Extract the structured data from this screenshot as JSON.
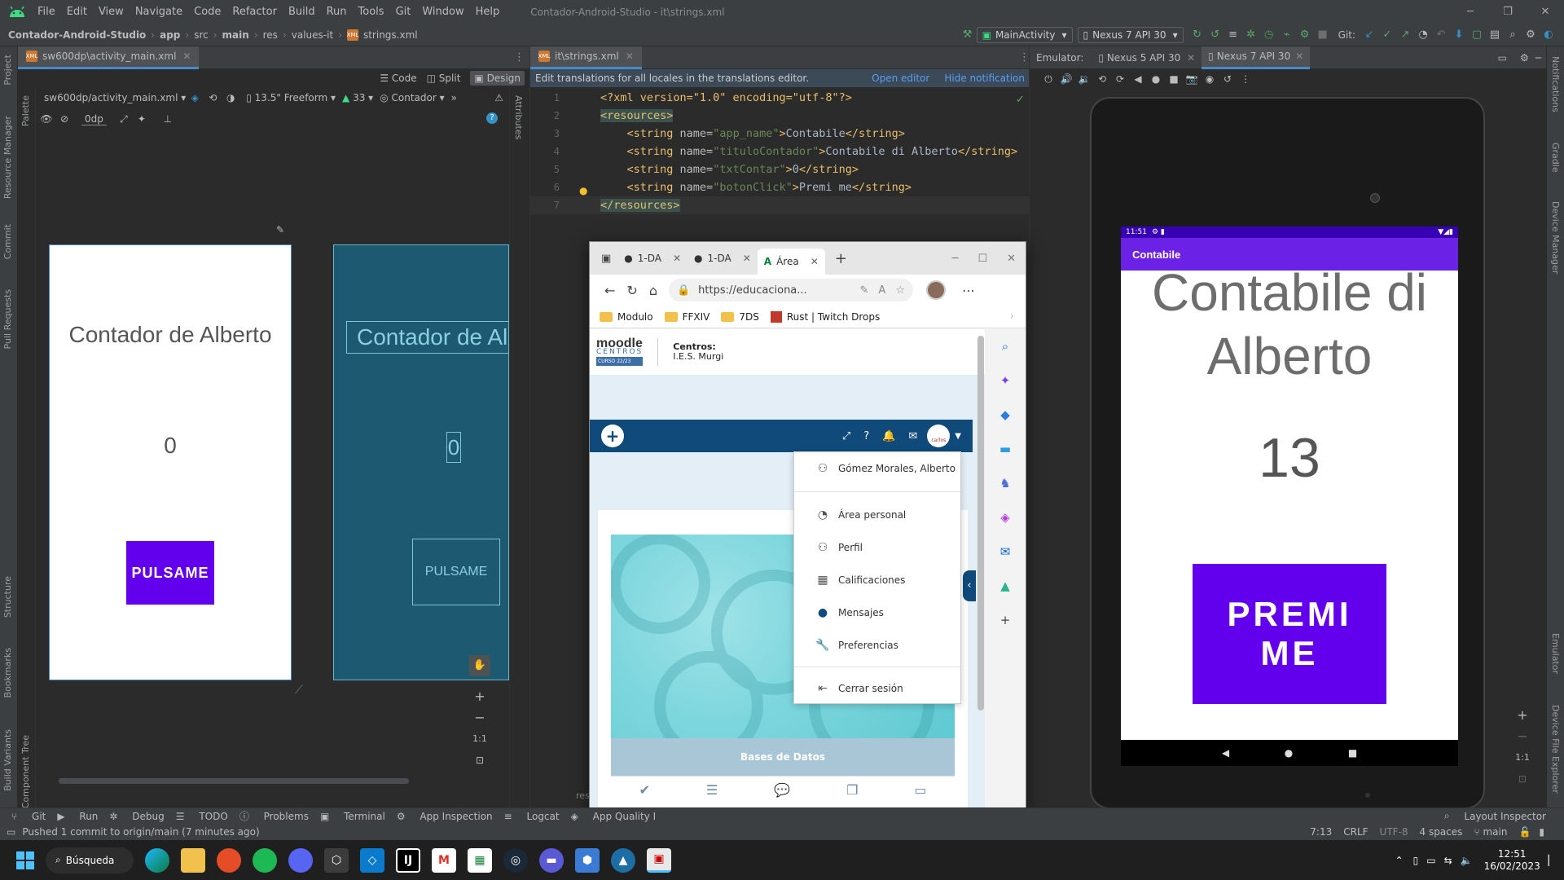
{
  "titlebar": {
    "menus": [
      "File",
      "Edit",
      "View",
      "Navigate",
      "Code",
      "Refactor",
      "Build",
      "Run",
      "Tools",
      "Git",
      "Window",
      "Help"
    ],
    "title": "Contador-Android-Studio - it\\strings.xml"
  },
  "navbar": {
    "crumbs": [
      "Contador-Android-Studio",
      "app",
      "src",
      "main",
      "res",
      "values-it",
      "strings.xml"
    ],
    "run_config": "MainActivity",
    "device": "Nexus 7 API 30",
    "git_label": "Git:"
  },
  "left_tabs": [
    "Project",
    "Resource Manager",
    "Commit",
    "Pull Requests",
    "Structure",
    "Bookmarks",
    "Build Variants"
  ],
  "right_tabs": [
    "Notifications",
    "Gradle",
    "Device Manager",
    "Emulator",
    "Device File Explorer"
  ],
  "design": {
    "tab_label": "sw600dp\\activity_main.xml",
    "modes": [
      "Code",
      "Split",
      "Design"
    ],
    "file_select": "sw600dp/activity_main.xml",
    "device_size": "13.5\" Freeform",
    "api": "33",
    "theme": "Contador",
    "margin": "0dp",
    "palette": "Palette",
    "component_tree": "Component Tree",
    "attributes": "Attributes",
    "preview_title": "Contador de Alberto",
    "preview_count": "0",
    "preview_button": "PULSAME",
    "blueprint_title": "Contador de Al",
    "blueprint_count": "0",
    "blueprint_button": "PULSAME",
    "zoom_fit": "1:1"
  },
  "editor": {
    "tab_label": "it\\strings.xml",
    "notification": "Edit translations for all locales in the translations editor.",
    "open_editor": "Open editor",
    "hide_notification": "Hide notification",
    "lines": [
      {
        "n": "1",
        "parts": [
          [
            "pi",
            "<?xml version=\"1.0\" encoding=\"utf-8\"?>"
          ]
        ]
      },
      {
        "n": "2",
        "parts": [
          [
            "tag",
            "<resources>"
          ]
        ]
      },
      {
        "n": "3",
        "parts": [
          [
            "tag",
            "    <string "
          ],
          [
            "attr",
            "name="
          ],
          [
            "val",
            "\"app_name\""
          ],
          [
            "tag",
            ">"
          ],
          [
            "txt",
            "Contabile"
          ],
          [
            "tag",
            "</string>"
          ]
        ]
      },
      {
        "n": "4",
        "parts": [
          [
            "tag",
            "    <string "
          ],
          [
            "attr",
            "name="
          ],
          [
            "val",
            "\"tituloContador\""
          ],
          [
            "tag",
            ">"
          ],
          [
            "txt",
            "Contabile di Alberto"
          ],
          [
            "tag",
            "</string>"
          ]
        ]
      },
      {
        "n": "5",
        "parts": [
          [
            "tag",
            "    <string "
          ],
          [
            "attr",
            "name="
          ],
          [
            "val",
            "\"txtContar\""
          ],
          [
            "tag",
            ">"
          ],
          [
            "txt",
            "0"
          ],
          [
            "tag",
            "</string>"
          ]
        ]
      },
      {
        "n": "6",
        "parts": [
          [
            "tag",
            "    <string "
          ],
          [
            "attr",
            "name="
          ],
          [
            "val",
            "\"botonClick\""
          ],
          [
            "tag",
            ">"
          ],
          [
            "txt",
            "Premi me"
          ],
          [
            "tag",
            "</string>"
          ]
        ]
      },
      {
        "n": "7",
        "parts": [
          [
            "tag",
            "</resources>"
          ]
        ]
      }
    ],
    "partial": "res"
  },
  "emulator": {
    "label": "Emulator:",
    "tabs": [
      "Nexus 5 API 30",
      "Nexus 7 API 30"
    ],
    "status_time": "11:51",
    "appbar_title": "Contabile",
    "title": "Contabile di Alberto",
    "count": "13",
    "button": "PREMI ME",
    "zoom_fit": "1:1"
  },
  "browser": {
    "tabs": [
      "1-DA",
      "1-DA",
      "Área"
    ],
    "url": "https://educaciona...",
    "bookmarks": [
      "Modulo",
      "FFXIV",
      "7DS",
      "Rust | Twitch Drops"
    ],
    "moodle_logo": "moodle",
    "moodle_sub": "CENTROS",
    "moodle_course": "CURSO 22/23",
    "centros_label": "Centros:",
    "centros_value": "I.E.S. Murgi",
    "avatar_label": "carlos",
    "user_menu": {
      "user": "Gómez Morales, Alberto",
      "items": [
        "Área personal",
        "Perfil",
        "Calificaciones",
        "Mensajes",
        "Preferencias"
      ],
      "logout": "Cerrar sesión"
    },
    "course_card": "Bases de Datos"
  },
  "toolwindows": [
    "Git",
    "Run",
    "Debug",
    "TODO",
    "Problems",
    "Terminal",
    "App Inspection",
    "Logcat",
    "App Quality I"
  ],
  "layout_inspector": "Layout Inspector",
  "status": {
    "message": "Pushed 1 commit to origin/main (7 minutes ago)",
    "position": "7:13",
    "line_sep": "CRLF",
    "encoding": "UTF-8",
    "indent": "4 spaces",
    "branch": "main"
  },
  "taskbar": {
    "search": "Búsqueda",
    "time": "12:51",
    "date": "16/02/2023"
  },
  "colors": {
    "ide_bg": "#2b2b2b",
    "ide_panel": "#3c3f41",
    "android_purple": "#6200ee",
    "appbar_purple": "#6b21e6",
    "moodle_blue": "#0f4a7a"
  }
}
